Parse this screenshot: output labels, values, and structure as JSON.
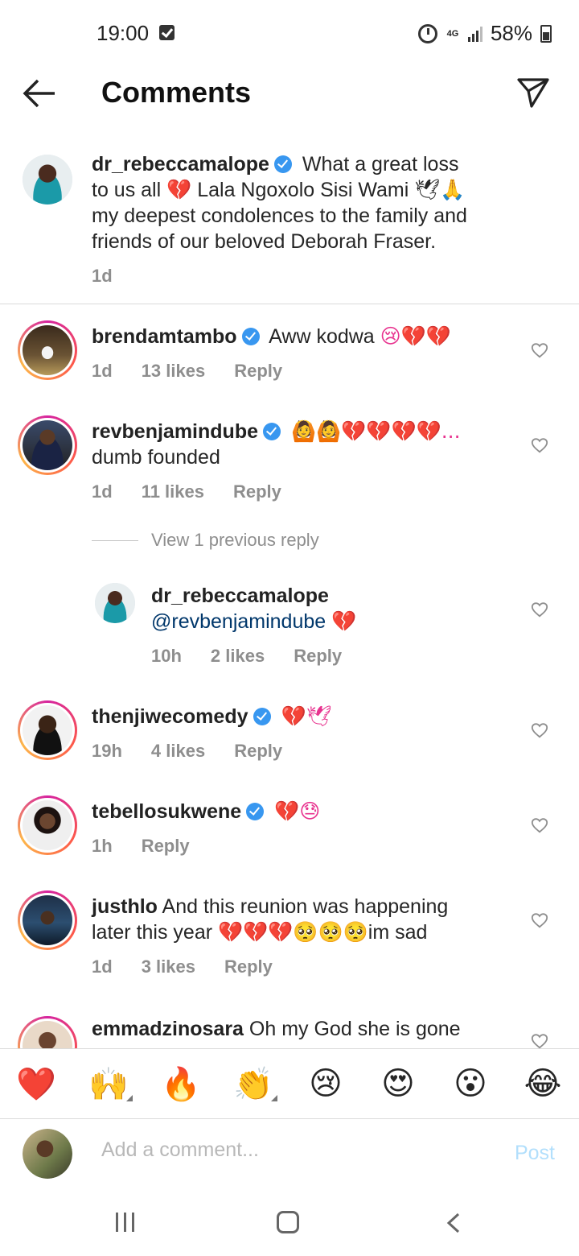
{
  "status_bar": {
    "time": "19:00",
    "network": "4G",
    "battery": "58%"
  },
  "header": {
    "title": "Comments"
  },
  "caption": {
    "username": "dr_rebeccamalope",
    "text_1": "What a great loss",
    "text_2": "to us all",
    "text_3": "Lala Ngoxolo Sisi Wami",
    "text_4": "my deepest condolences to the family and",
    "text_5": "friends of our beloved Deborah Fraser.",
    "time": "1d"
  },
  "comments": [
    {
      "username": "brendamtambo",
      "text": "Aww kodwa",
      "emojis": "😢💔💔",
      "time": "1d",
      "likes": "13 likes",
      "reply": "Reply"
    },
    {
      "username": "revbenjamindube",
      "emojis": "🙆🙆💔💔💔💔...",
      "text": "dumb founded",
      "time": "1d",
      "likes": "11 likes",
      "reply": "Reply"
    },
    {
      "username": "thenjiwecomedy",
      "emojis": "💔🕊",
      "time": "19h",
      "likes": "4 likes",
      "reply": "Reply"
    },
    {
      "username": "tebellosukwene",
      "emojis": "💔😓",
      "time": "1h",
      "reply": "Reply"
    },
    {
      "username": "justhlo",
      "text_1": "And this reunion was happening",
      "text_2": "later this year",
      "emojis": "💔💔💔🥺🥺🥺",
      "text_3": "im sad",
      "time": "1d",
      "likes": "3 likes",
      "reply": "Reply"
    },
    {
      "username": "emmadzinosara",
      "text": "Oh my God she is gone"
    }
  ],
  "view_replies": "View 1 previous reply",
  "reply": {
    "username": "dr_rebeccamalope",
    "mention": "@revbenjamindube",
    "emojis": "💔",
    "time": "10h",
    "likes": "2 likes",
    "reply": "Reply"
  },
  "emoji_bar": [
    "❤️",
    "🙌",
    "🔥",
    "👏",
    "😢",
    "😍",
    "😮",
    "😂"
  ],
  "comment_box": {
    "placeholder": "Add a comment...",
    "post_label": "Post"
  },
  "colors": {
    "verified": "#3897f0",
    "link": "#00376b",
    "post_disabled": "#b2dffc",
    "meta": "#8e8e8e"
  }
}
